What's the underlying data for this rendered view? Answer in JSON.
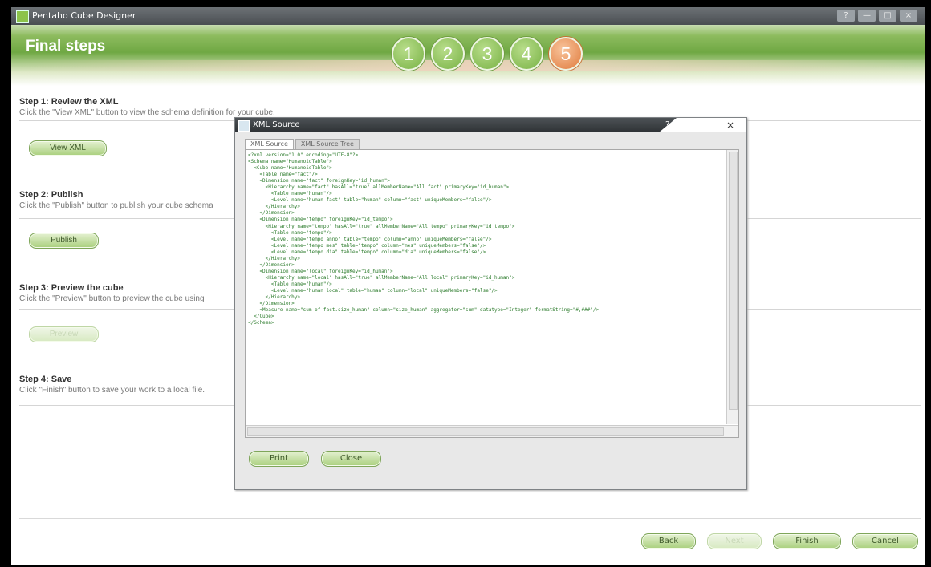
{
  "window": {
    "title": "Pentaho Cube Designer",
    "help": "?",
    "minimize": "—",
    "maximize": "□",
    "close": "×"
  },
  "header": {
    "title": "Final steps",
    "steps": [
      "1",
      "2",
      "3",
      "4",
      "5"
    ],
    "active_step": "5"
  },
  "sections": [
    {
      "heading": "Step 1: Review the XML",
      "desc": "Click the \"View XML\" button to view the schema definition for your cube.",
      "button": "View XML"
    },
    {
      "heading": "Step 2: Publish",
      "desc": "Click the \"Publish\" button to publish your cube schema",
      "button": "Publish"
    },
    {
      "heading": "Step 3: Preview the cube",
      "desc": "Click the \"Preview\" button to preview the cube using",
      "button": "Preview"
    },
    {
      "heading": "Step 4: Save",
      "desc": "Click \"Finish\" button to save your work to a local file."
    }
  ],
  "dialog": {
    "title": "XML Source",
    "help": "?",
    "close": "×",
    "tabs": [
      "XML Source",
      "XML Source Tree"
    ],
    "xml_lines": [
      "<?xml version=\"1.0\" encoding=\"UTF-8\"?>",
      "<Schema name=\"HumanoidTable\">",
      "  <Cube name=\"HumanoidTable\">",
      "    <Table name=\"fact\"/>",
      "    <Dimension name=\"fact\" foreignKey=\"id_human\">",
      "      <Hierarchy name=\"fact\" hasAll=\"true\" allMemberName=\"All fact\" primaryKey=\"id_human\">",
      "        <Table name=\"human\"/>",
      "        <Level name=\"human fact\" table=\"human\" column=\"fact\" uniqueMembers=\"false\"/>",
      "      </Hierarchy>",
      "    </Dimension>",
      "    <Dimension name=\"tempo\" foreignKey=\"id_tempo\">",
      "      <Hierarchy name=\"tempo\" hasAll=\"true\" allMemberName=\"All tempo\" primaryKey=\"id_tempo\">",
      "        <Table name=\"tempo\"/>",
      "        <Level name=\"tempo anno\" table=\"tempo\" column=\"anno\" uniqueMembers=\"false\"/>",
      "        <Level name=\"tempo mes\" table=\"tempo\" column=\"mes\" uniqueMembers=\"false\"/>",
      "        <Level name=\"tempo dia\" table=\"tempo\" column=\"dia\" uniqueMembers=\"false\"/>",
      "      </Hierarchy>",
      "    </Dimension>",
      "    <Dimension name=\"local\" foreignKey=\"id_human\">",
      "      <Hierarchy name=\"local\" hasAll=\"true\" allMemberName=\"All local\" primaryKey=\"id_human\">",
      "        <Table name=\"human\"/>",
      "        <Level name=\"human local\" table=\"human\" column=\"local\" uniqueMembers=\"false\"/>",
      "      </Hierarchy>",
      "    </Dimension>",
      "    <Measure name=\"sum of fact.size_human\" column=\"size_human\" aggregator=\"sum\" datatype=\"Integer\" formatString=\"#,###\"/>",
      "  </Cube>",
      "</Schema>"
    ],
    "buttons": {
      "print": "Print",
      "close": "Close"
    }
  },
  "footer": {
    "back": "Back",
    "next": "Next",
    "finish": "Finish",
    "cancel": "Cancel"
  }
}
